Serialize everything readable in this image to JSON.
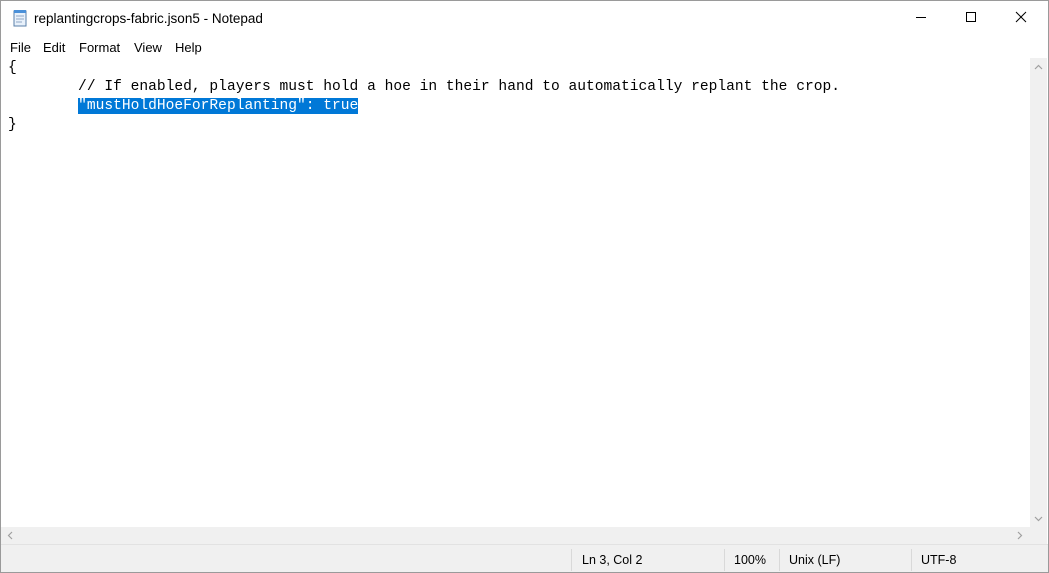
{
  "window": {
    "title": "replantingcrops-fabric.json5 - Notepad",
    "icon": "notepad-icon",
    "controls": [
      "minimize-icon",
      "maximize-icon",
      "close-icon"
    ]
  },
  "menu": {
    "items": [
      {
        "label": "File"
      },
      {
        "label": "Edit"
      },
      {
        "label": "Format"
      },
      {
        "label": "View"
      },
      {
        "label": "Help"
      }
    ]
  },
  "editor": {
    "lines": [
      "{",
      "        // If enabled, players must hold a hoe in their hand to automatically replant the crop.",
      "        ",
      "}"
    ],
    "selected_text": "\"mustHoldHoeForReplanting\": true",
    "selection_color": "#0078d7"
  },
  "status": {
    "position": "Ln 3, Col 2",
    "zoom": "100%",
    "line_ending": "Unix (LF)",
    "encoding": "UTF-8"
  }
}
